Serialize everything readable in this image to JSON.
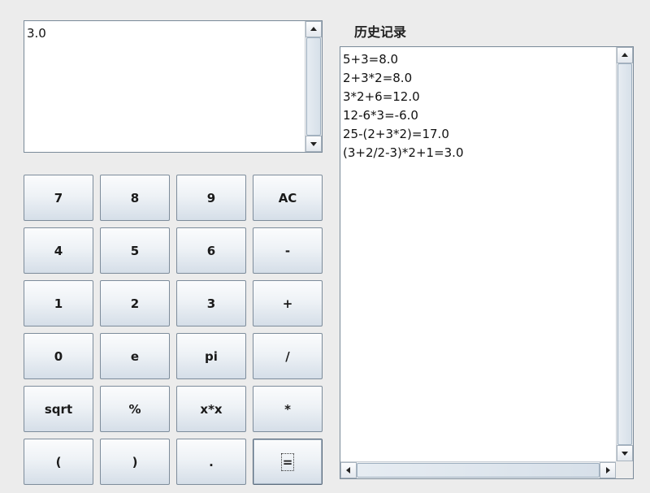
{
  "display": {
    "value": "3.0"
  },
  "keypad": {
    "rows": [
      [
        "7",
        "8",
        "9",
        "AC"
      ],
      [
        "4",
        "5",
        "6",
        "-"
      ],
      [
        "1",
        "2",
        "3",
        "+"
      ],
      [
        "0",
        "e",
        "pi",
        "/"
      ],
      [
        "sqrt",
        "%",
        "x*x",
        "*"
      ],
      [
        "(",
        ")",
        ".",
        "="
      ]
    ]
  },
  "history": {
    "title": "历史记录",
    "entries": [
      "5+3=8.0",
      "2+3*2=8.0",
      "3*2+6=12.0",
      "12-6*3=-6.0",
      "25-(2+3*2)=17.0",
      "(3+2/2-3)*2+1=3.0"
    ]
  },
  "icons": {
    "scroll_up": "arrow-up-icon",
    "scroll_down": "arrow-down-icon",
    "scroll_left": "arrow-left-icon",
    "scroll_right": "arrow-right-icon"
  }
}
